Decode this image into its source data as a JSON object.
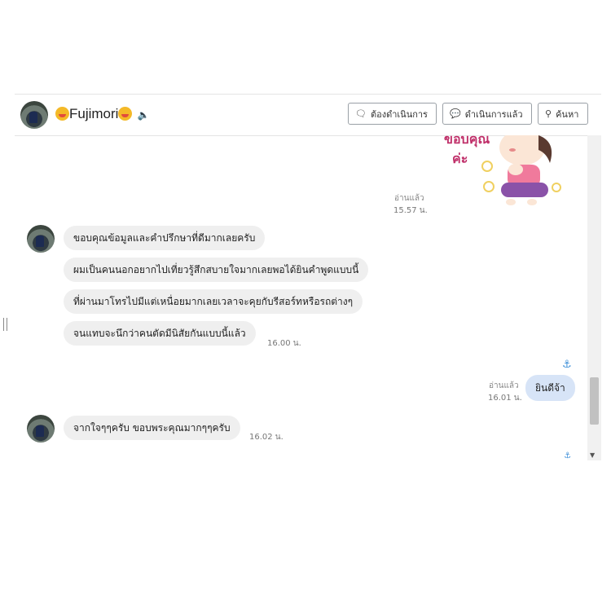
{
  "header": {
    "contact_name": "Fujimori",
    "buttons": {
      "todo": "ต้องดำเนินการ",
      "done": "ดำเนินการแล้ว",
      "search": "ค้นหา"
    }
  },
  "sticker": {
    "text_line1": "ขอบคุณ",
    "text_line2": "ค่ะ"
  },
  "messages": {
    "sticker_read": "อ่านแล้ว",
    "sticker_time": "15.57 น.",
    "in1": "ขอบคุณข้อมูลและคำปรึกษาที่ดีมากเลยครับ",
    "in2": "ผมเป็นคนนอกอยากไปเที่ยวรู้สึกสบายใจมากเลยพอได้ยินคำพูดแบบนี้",
    "in3": "ที่ผ่านมาโทรไปมีแต่เหนื่อยมากเลยเวลาจะคุยกับรีสอร์ทหรือรถต่างๆ",
    "in4": "จนแทบจะนึกว่าคนตัดมีนิสัยกันแบบนี้แล้ว",
    "in4_time": "16.00 น.",
    "out1": "ยินดีจ้า",
    "out1_read": "อ่านแล้ว",
    "out1_time": "16.01 น.",
    "in5": "จากใจๆๆครับ ขอบพระคุณมากๆๆครับ",
    "in5_time": "16.02 น."
  },
  "colors": {
    "incoming_bubble": "#efefef",
    "outgoing_bubble": "#d7e4f7",
    "anchor_accent": "#3b8ed8"
  },
  "icons": {
    "speaker": "speaker-icon",
    "todo": "speech-bubble-icon",
    "done": "chat-check-icon",
    "search": "search-icon",
    "anchor": "anchor-icon"
  }
}
